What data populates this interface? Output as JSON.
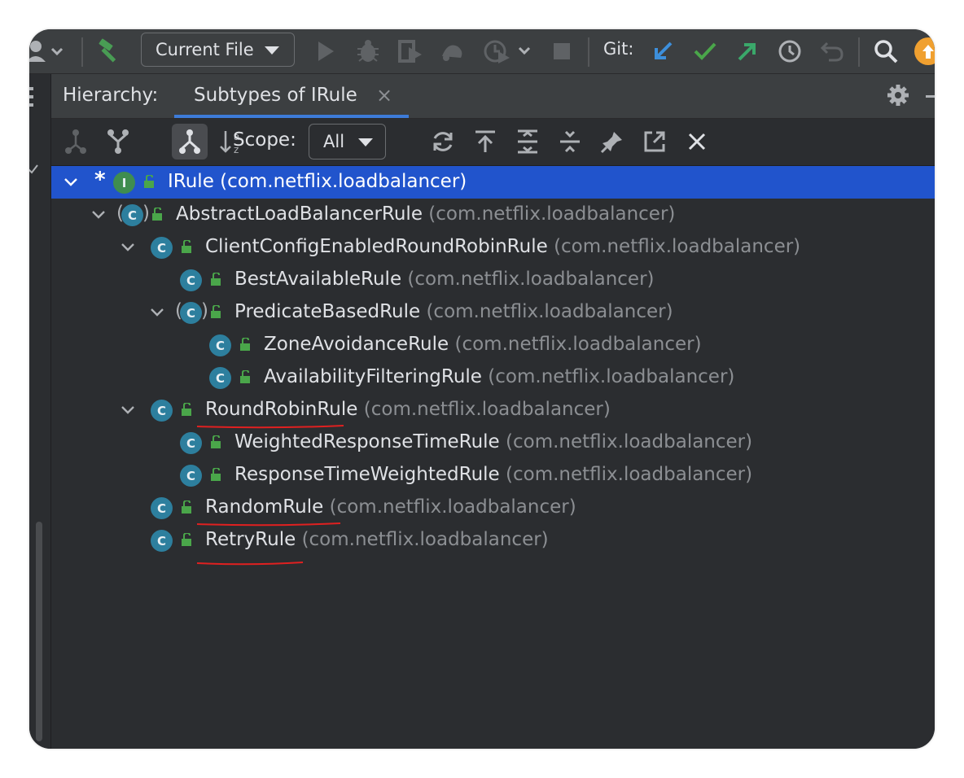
{
  "toolbar": {
    "run_config": "Current File",
    "git_label": "Git:",
    "icons": [
      "user-icon",
      "build-hammer-icon",
      "run-icon",
      "debug-icon",
      "coverage-icon",
      "profile-icon",
      "attach-icon",
      "stop-icon",
      "git-update-icon",
      "git-commit-icon",
      "git-push-icon",
      "history-icon",
      "rollback-icon",
      "search-icon",
      "update-available-icon"
    ],
    "colors": {
      "build": "#499c54",
      "git_update": "#3d8fdb",
      "git_commit": "#4aa64a",
      "git_push": "#3aa86a",
      "update_badge": "#f0a030"
    }
  },
  "hierarchy": {
    "title": "Hierarchy:",
    "tab_label": "Subtypes of IRule",
    "tab_close": "×",
    "scope_label": "Scope:",
    "scope_value": "All"
  },
  "tree": {
    "nodes": [
      {
        "name": "IRule",
        "pkg": "(com.netflix.loadbalancer)",
        "kind": "interface",
        "selected": true,
        "expanded": true,
        "marked": true
      },
      {
        "name": "AbstractLoadBalancerRule",
        "pkg": "(com.netflix.loadbalancer)",
        "kind": "abstract",
        "expanded": true
      },
      {
        "name": "ClientConfigEnabledRoundRobinRule",
        "pkg": "(com.netflix.loadbalancer)",
        "kind": "class",
        "expanded": true
      },
      {
        "name": "BestAvailableRule",
        "pkg": "(com.netflix.loadbalancer)",
        "kind": "class"
      },
      {
        "name": "PredicateBasedRule",
        "pkg": "(com.netflix.loadbalancer)",
        "kind": "abstract",
        "expanded": true
      },
      {
        "name": "ZoneAvoidanceRule",
        "pkg": "(com.netflix.loadbalancer)",
        "kind": "class"
      },
      {
        "name": "AvailabilityFilteringRule",
        "pkg": "(com.netflix.loadbalancer)",
        "kind": "class"
      },
      {
        "name": "RoundRobinRule",
        "pkg": "(com.netflix.loadbalancer)",
        "kind": "class",
        "expanded": true,
        "underlined": true
      },
      {
        "name": "WeightedResponseTimeRule",
        "pkg": "(com.netflix.loadbalancer)",
        "kind": "class"
      },
      {
        "name": "ResponseTimeWeightedRule",
        "pkg": "(com.netflix.loadbalancer)",
        "kind": "class"
      },
      {
        "name": "RandomRule",
        "pkg": "(com.netflix.loadbalancer)",
        "kind": "class",
        "underlined": true
      },
      {
        "name": "RetryRule",
        "pkg": "(com.netflix.loadbalancer)",
        "kind": "class",
        "underlined": true
      }
    ]
  },
  "colors": {
    "selection": "#2154cc",
    "class_icon": "#2d7f9e",
    "interface_icon": "#3f8d4f",
    "annotation_underline": "#e02020"
  }
}
